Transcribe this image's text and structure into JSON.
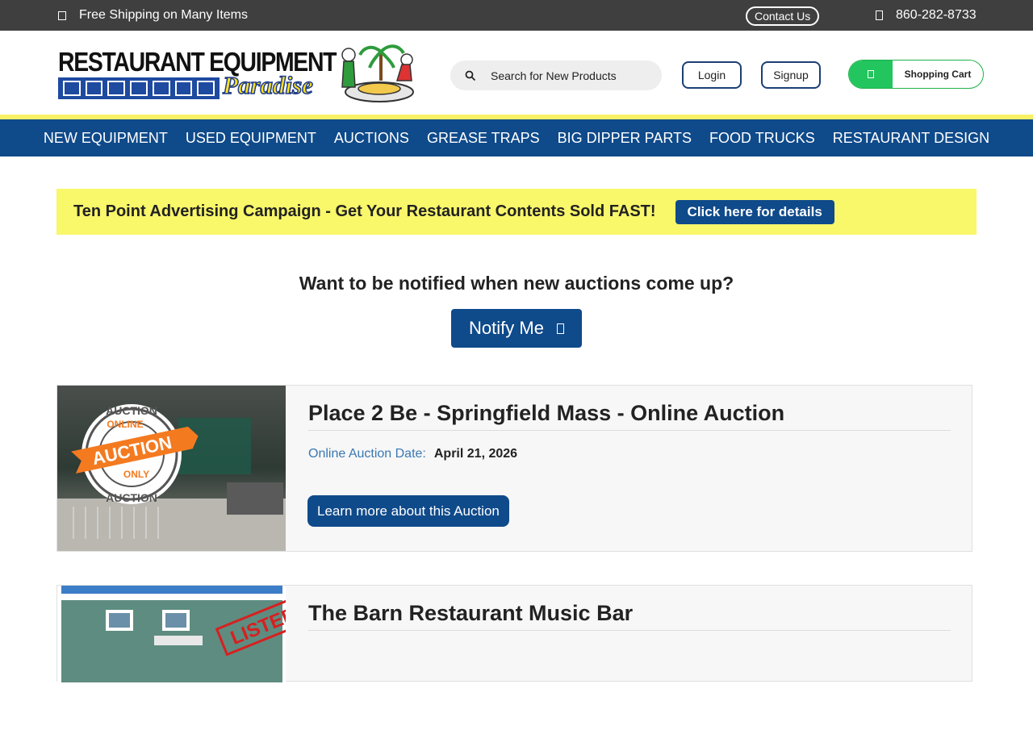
{
  "topbar": {
    "shipping": "Free Shipping on Many Items",
    "contact": "Contact Us",
    "phone": "860-282-8733"
  },
  "header": {
    "logo_line1": "RESTAURANT EQUIPMENT",
    "logo_line2": "Paradise",
    "search_placeholder": "Search for New Products",
    "login": "Login",
    "signup": "Signup",
    "cart": "Shopping Cart"
  },
  "nav": [
    "NEW EQUIPMENT",
    "USED EQUIPMENT",
    "AUCTIONS",
    "GREASE TRAPS",
    "BIG DIPPER PARTS",
    "FOOD TRUCKS",
    "RESTAURANT DESIGN"
  ],
  "promo": {
    "text": "Ten Point Advertising Campaign - Get Your Restaurant Contents Sold FAST!",
    "button": "Click here for details"
  },
  "notify": {
    "question": "Want to be notified when new auctions come up?",
    "button": "Notify Me"
  },
  "auctions": [
    {
      "title": "Place 2 Be - Springfield Mass - Online Auction",
      "date_label": "Online Auction Date:",
      "date": "April 21, 2026",
      "button": "Learn more about this Auction",
      "badge_top": "AUCTION",
      "badge_online": "ONLINE",
      "badge_main": "AUCTION",
      "badge_only": "ONLY"
    },
    {
      "title": "The Barn Restaurant Music Bar",
      "stamp": "LISTED"
    }
  ]
}
